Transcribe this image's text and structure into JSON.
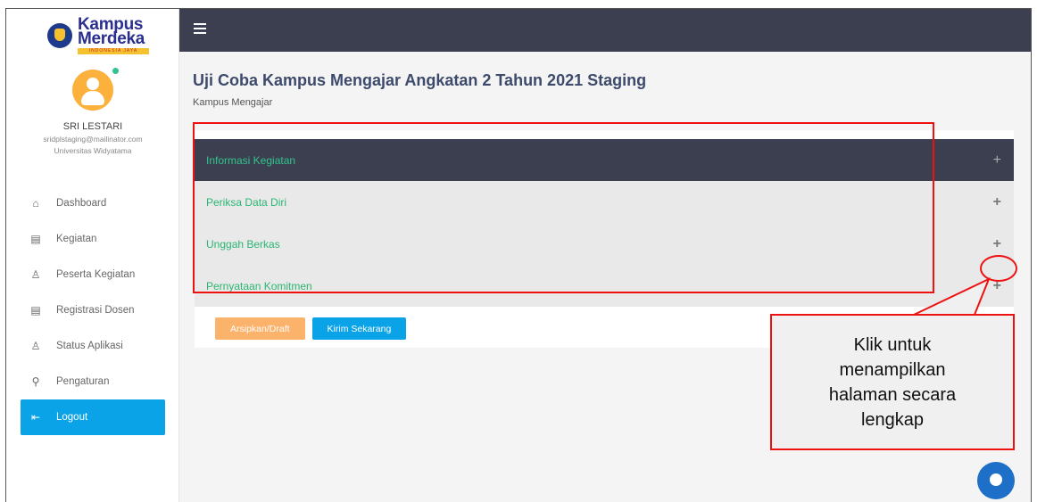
{
  "logo": {
    "line1": "Kampus",
    "line2": "Merdeka",
    "tagline": "INDONESIA JAYA"
  },
  "user": {
    "name": "SRI LESTARI",
    "email": "sridplstaging@mailinator.com",
    "university": "Universitas Widyatama"
  },
  "sidebar": {
    "items": [
      {
        "label": "Dashboard",
        "icon": "home-icon"
      },
      {
        "label": "Kegiatan",
        "icon": "message-icon"
      },
      {
        "label": "Peserta Kegiatan",
        "icon": "person-icon"
      },
      {
        "label": "Registrasi Dosen",
        "icon": "message-icon"
      },
      {
        "label": "Status Aplikasi",
        "icon": "person-icon"
      },
      {
        "label": "Pengaturan",
        "icon": "wrench-icon"
      }
    ],
    "logout": {
      "label": "Logout",
      "icon": "logout-icon"
    }
  },
  "header": {
    "menu_icon": "hamburger-icon"
  },
  "main": {
    "title": "Uji Coba Kampus Mengajar Angkatan 2 Tahun 2021 Staging",
    "subtitle": "Kampus Mengajar",
    "accordion": [
      {
        "label": "Informasi Kegiatan",
        "active": true
      },
      {
        "label": "Periksa Data Diri",
        "active": false
      },
      {
        "label": "Unggah Berkas",
        "active": false
      },
      {
        "label": "Pernyataan Komitmen",
        "active": false
      }
    ],
    "buttons": {
      "draft": "Arsipkan/Draft",
      "send": "Kirim Sekarang"
    }
  },
  "annotation": {
    "callout_lines": [
      "Klik untuk",
      "menampilkan",
      "halaman secara",
      "lengkap"
    ]
  },
  "colors": {
    "topbar": "#3b3f4f",
    "accent_blue": "#0aa3e8",
    "accent_green": "#2bb673",
    "draft_orange": "#fbb26b",
    "annotation_red": "#e11111"
  }
}
